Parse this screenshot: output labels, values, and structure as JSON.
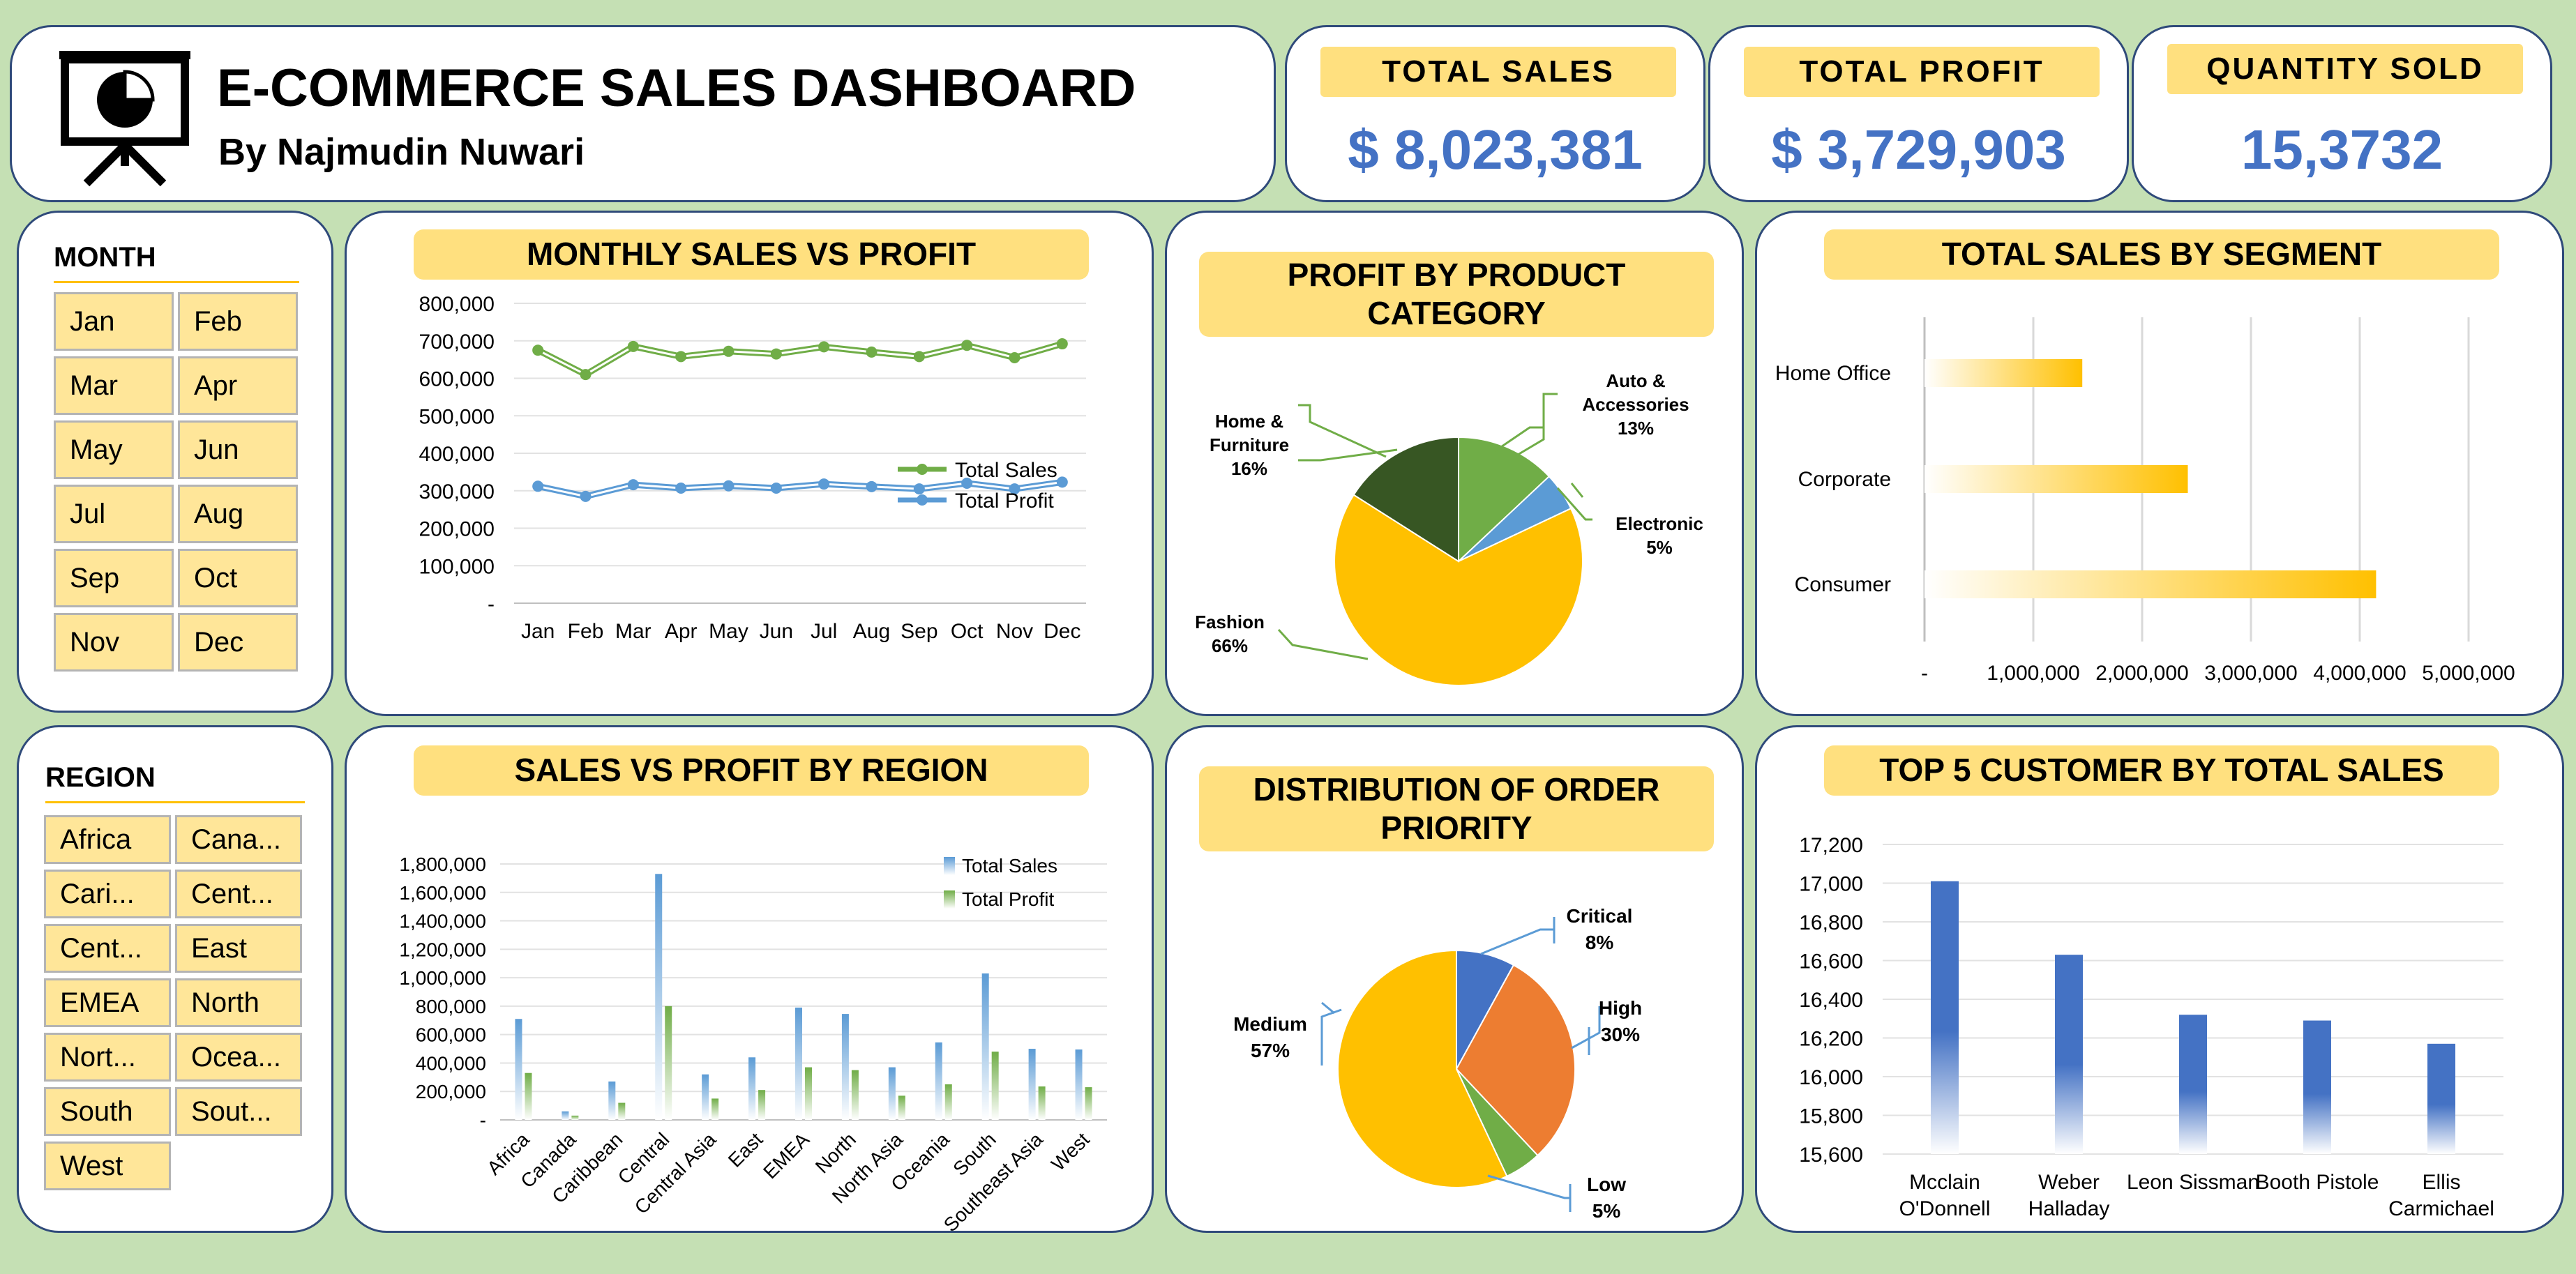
{
  "header": {
    "title": "E-COMMERCE SALES DASHBOARD",
    "subtitle": "By Najmudin Nuwari",
    "icon": "presentation-board-icon"
  },
  "kpis": [
    {
      "label": "TOTAL SALES",
      "value": "$ 8,023,381"
    },
    {
      "label": "TOTAL PROFIT",
      "value": "$ 3,729,903"
    },
    {
      "label": "QUANTITY SOLD",
      "value": "15,3732"
    }
  ],
  "month_slicer": {
    "heading": "MONTH",
    "items": [
      "Jan",
      "Feb",
      "Mar",
      "Apr",
      "May",
      "Jun",
      "Jul",
      "Aug",
      "Sep",
      "Oct",
      "Nov",
      "Dec"
    ]
  },
  "region_slicer": {
    "heading": "REGION",
    "items": [
      "Africa",
      "Cana...",
      "Cari...",
      "Cent...",
      "Cent...",
      "East",
      "EMEA",
      "North",
      "Nort...",
      "Ocea...",
      "South",
      "Sout...",
      "West"
    ]
  },
  "colors": {
    "sales_green": "#70ad47",
    "profit_blue": "#5b9bd5",
    "accent_yellow": "#ffc000",
    "bar_blue": "#4472c4",
    "orange": "#ed7d31",
    "dark_green": "#375623",
    "kpi_blue": "#4472c4",
    "panel_border": "#2f4a7a",
    "title_yellow": "#ffe07f"
  },
  "chart_titles": {
    "monthly": "MONTHLY SALES VS PROFIT",
    "category": "PROFIT BY PRODUCT CATEGORY",
    "segment": "TOTAL SALES BY SEGMENT",
    "region": "SALES VS PROFIT BY REGION",
    "priority": "DISTRIBUTION OF ORDER PRIORITY",
    "customers": "TOP 5 CUSTOMER BY TOTAL SALES"
  },
  "chart_data": [
    {
      "id": "monthly",
      "type": "line",
      "title": "MONTHLY SALES VS PROFIT",
      "categories": [
        "Jan",
        "Feb",
        "Mar",
        "Apr",
        "May",
        "Jun",
        "Jul",
        "Aug",
        "Sep",
        "Oct",
        "Nov",
        "Dec"
      ],
      "series": [
        {
          "name": "Total Sales",
          "values": [
            675000,
            610000,
            685000,
            658000,
            672000,
            665000,
            684000,
            670000,
            658000,
            688000,
            655000,
            692000
          ]
        },
        {
          "name": "Total Profit",
          "values": [
            312000,
            285000,
            316000,
            307000,
            313000,
            307000,
            318000,
            311000,
            305000,
            320000,
            305000,
            323000
          ]
        }
      ],
      "yticks": [
        "800,000",
        "700,000",
        "600,000",
        "500,000",
        "400,000",
        "300,000",
        "200,000",
        "100,000",
        "-"
      ],
      "ylim": [
        0,
        800000
      ],
      "legend_position": "bottom-right"
    },
    {
      "id": "category",
      "type": "pie",
      "title": "PROFIT BY PRODUCT CATEGORY",
      "slices": [
        {
          "name": "Auto & Accessories",
          "value": 13
        },
        {
          "name": "Electronic",
          "value": 5
        },
        {
          "name": "Fashion",
          "value": 66
        },
        {
          "name": "Home & Furniture",
          "value": 16
        }
      ],
      "labels": [
        {
          "lines": [
            "Auto &",
            "Accessories",
            "13%"
          ]
        },
        {
          "lines": [
            "Electronic",
            "5%"
          ]
        },
        {
          "lines": [
            "Fashion",
            "66%"
          ]
        },
        {
          "lines": [
            "Home &",
            "Furniture",
            "16%"
          ]
        }
      ]
    },
    {
      "id": "segment",
      "type": "bar",
      "orientation": "horizontal",
      "title": "TOTAL SALES BY SEGMENT",
      "categories": [
        "Home Office",
        "Corporate",
        "Consumer"
      ],
      "values": [
        1450000,
        2420000,
        4150000
      ],
      "xticks": [
        "-",
        "1,000,000",
        "2,000,000",
        "3,000,000",
        "4,000,000",
        "5,000,000"
      ],
      "xlim": [
        0,
        5000000
      ]
    },
    {
      "id": "region",
      "type": "bar",
      "title": "SALES VS PROFIT BY REGION",
      "categories": [
        "Africa",
        "Canada",
        "Caribbean",
        "Central",
        "Central Asia",
        "East",
        "EMEA",
        "North",
        "North Asia",
        "Oceania",
        "South",
        "Southeast Asia",
        "West"
      ],
      "series": [
        {
          "name": "Total Sales",
          "values": [
            710000,
            60000,
            270000,
            1730000,
            320000,
            440000,
            790000,
            745000,
            370000,
            545000,
            1030000,
            500000,
            495000
          ]
        },
        {
          "name": "Total Profit",
          "values": [
            330000,
            30000,
            120000,
            800000,
            150000,
            210000,
            370000,
            350000,
            170000,
            250000,
            480000,
            235000,
            230000
          ]
        }
      ],
      "yticks": [
        "1,800,000",
        "1,600,000",
        "1,400,000",
        "1,200,000",
        "1,000,000",
        "800,000",
        "600,000",
        "400,000",
        "200,000",
        "-"
      ],
      "ylim": [
        0,
        1800000
      ],
      "legend_position": "top-right"
    },
    {
      "id": "priority",
      "type": "pie",
      "title": "DISTRIBUTION OF ORDER PRIORITY",
      "slices": [
        {
          "name": "Critical",
          "value": 8
        },
        {
          "name": "High",
          "value": 30
        },
        {
          "name": "Low",
          "value": 5
        },
        {
          "name": "Medium",
          "value": 57
        }
      ],
      "labels": [
        {
          "lines": [
            "Critical",
            "8%"
          ]
        },
        {
          "lines": [
            "High",
            "30%"
          ]
        },
        {
          "lines": [
            "Low",
            "5%"
          ]
        },
        {
          "lines": [
            "Medium",
            "57%"
          ]
        }
      ]
    },
    {
      "id": "customers",
      "type": "bar",
      "title": "TOP 5 CUSTOMER BY TOTAL SALES",
      "categories": [
        [
          "Mcclain",
          "O'Donnell"
        ],
        [
          "Weber",
          "Halladay"
        ],
        [
          "Leon Sissman"
        ],
        [
          "Booth Pistole"
        ],
        [
          "Ellis",
          "Carmichael"
        ]
      ],
      "values": [
        17010,
        16630,
        16320,
        16290,
        16170
      ],
      "yticks": [
        "17,200",
        "17,000",
        "16,800",
        "16,600",
        "16,400",
        "16,200",
        "16,000",
        "15,800",
        "15,600"
      ],
      "ylim": [
        15600,
        17200
      ]
    }
  ]
}
